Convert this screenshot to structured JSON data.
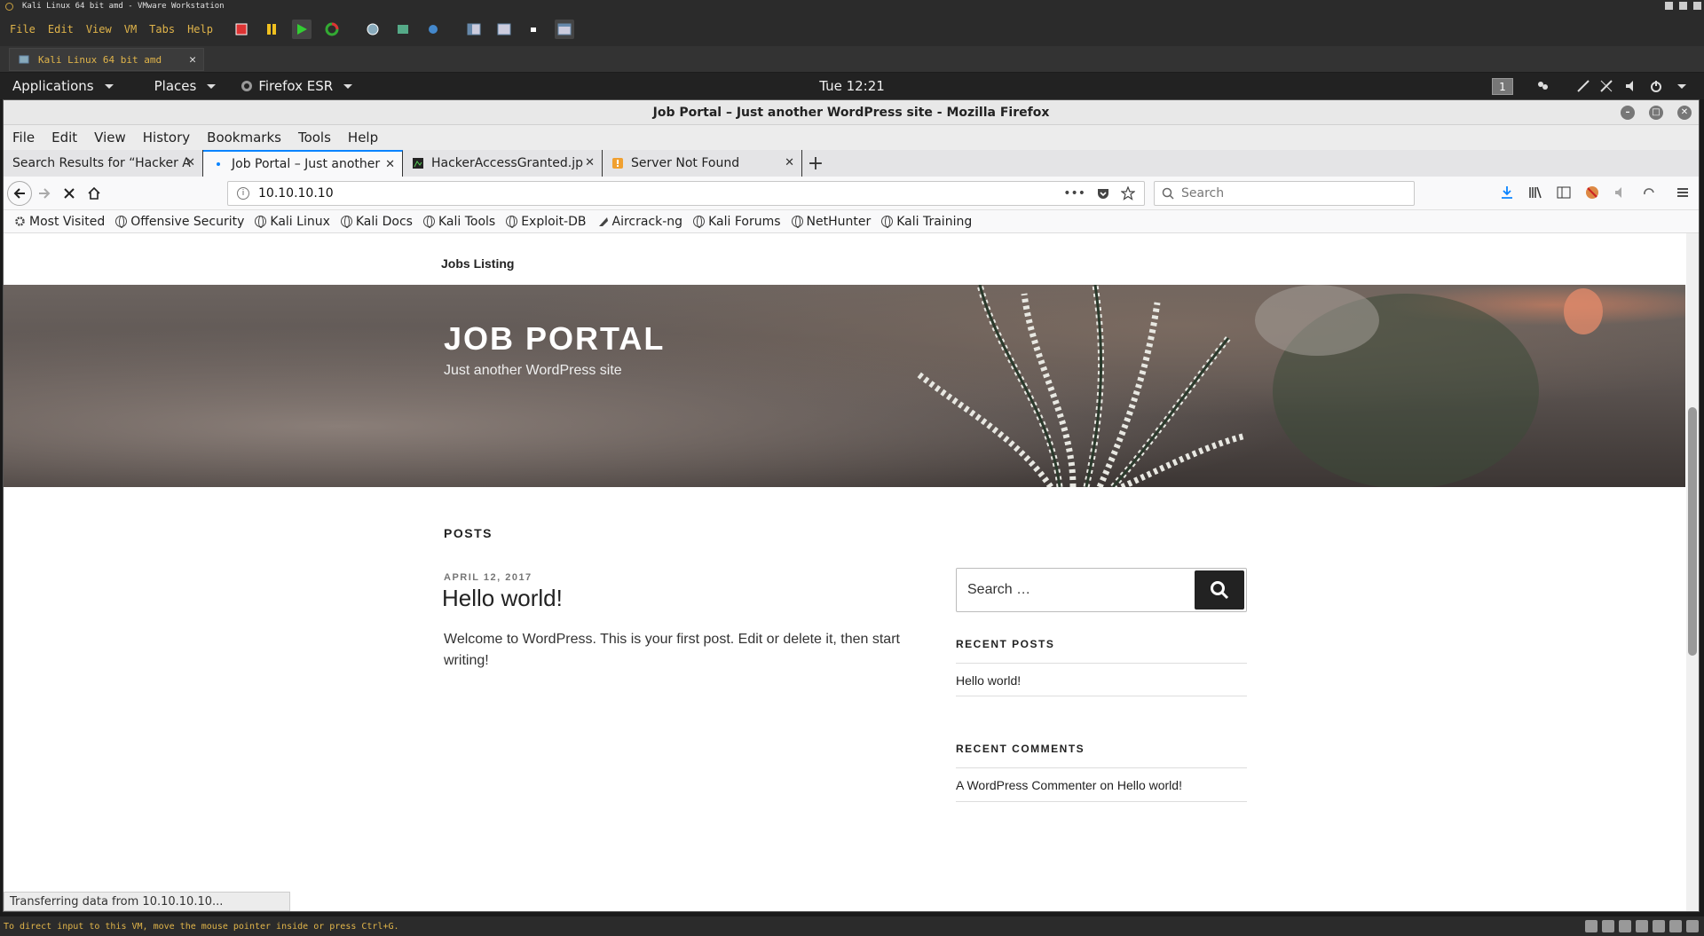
{
  "vmware": {
    "title": "Kali Linux 64 bit amd - VMware Workstation",
    "menu": [
      "File",
      "Edit",
      "View",
      "VM",
      "Tabs",
      "Help"
    ],
    "tab_label": "Kali Linux 64 bit amd",
    "status_text": "To direct input to this VM, move the mouse pointer inside or press Ctrl+G."
  },
  "kali_panel": {
    "applications": "Applications",
    "places": "Places",
    "firefox": "Firefox ESR",
    "clock": "Tue 12:21",
    "workspace": "1"
  },
  "firefox": {
    "window_title": "Job Portal – Just another WordPress site - Mozilla Firefox",
    "menu": [
      "File",
      "Edit",
      "View",
      "History",
      "Bookmarks",
      "Tools",
      "Help"
    ],
    "tabs": [
      {
        "label": "Search Results for “Hacker A",
        "active": false
      },
      {
        "label": "Job Portal – Just another",
        "active": true
      },
      {
        "label": "HackerAccessGranted.jp",
        "active": false
      },
      {
        "label": "Server Not Found",
        "active": false
      }
    ],
    "url": "10.10.10.10",
    "search_placeholder": "Search",
    "bookmarks": [
      "Most Visited",
      "Offensive Security",
      "Kali Linux",
      "Kali Docs",
      "Kali Tools",
      "Exploit-DB",
      "Aircrack-ng",
      "Kali Forums",
      "NetHunter",
      "Kali Training"
    ],
    "status": "Transferring data from 10.10.10.10..."
  },
  "page": {
    "nav_link": "Jobs Listing",
    "site_title": "JOB PORTAL",
    "tagline": "Just another WordPress site",
    "posts_heading": "POSTS",
    "post": {
      "date": "APRIL 12, 2017",
      "title": "Hello world!",
      "body": "Welcome to WordPress. This is your first post. Edit or delete it, then start writing!"
    },
    "sidebar": {
      "search_placeholder": "Search …",
      "recent_posts_heading": "RECENT POSTS",
      "recent_posts": [
        "Hello world!"
      ],
      "recent_comments_heading": "RECENT COMMENTS",
      "comment_author": "A WordPress Commenter",
      "comment_on": "on",
      "comment_post": "Hello world!"
    }
  }
}
